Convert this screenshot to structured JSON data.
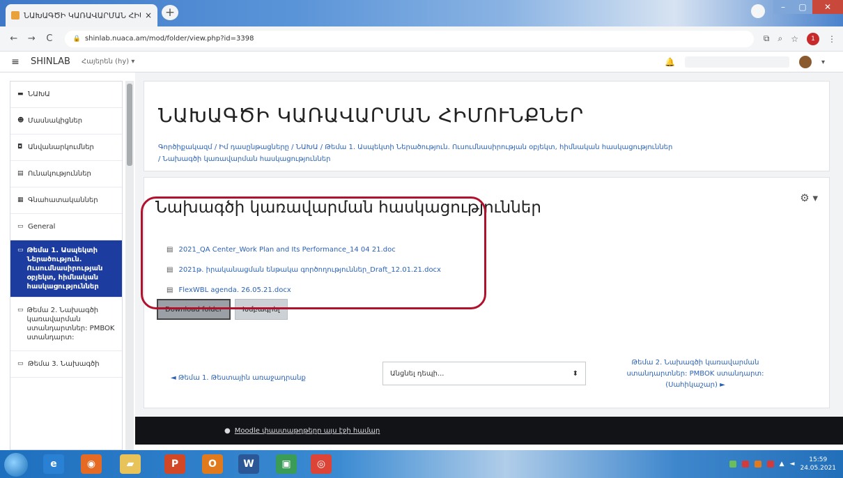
{
  "browser": {
    "tab_title": "ՆԱԽԱԳԾԻ ԿԱՌԱՎԱՐՄԱՆ ՀԻՄՈՒՆՔՆԵՐ",
    "tab_close": "×",
    "new_tab": "+",
    "url": "shinlab.nuaca.am/mod/folder/view.php?id=3398",
    "profile_initial": "1"
  },
  "moodle_nav": {
    "brand": "SHINLAB",
    "language": "Հայերեն (hy) ▾",
    "menu_icon": "≡"
  },
  "sidebar": {
    "items": [
      {
        "icon": "▬",
        "label": "ՆԱԽԱ"
      },
      {
        "icon": "☻",
        "label": "Մասնակիցներ"
      },
      {
        "icon": "◘",
        "label": "Անվանարկումներ"
      },
      {
        "icon": "▤",
        "label": "Ունակություններ"
      },
      {
        "icon": "▦",
        "label": "Գնահատականներ"
      },
      {
        "icon": "▭",
        "label": "General"
      },
      {
        "icon": "▭",
        "label": "Թեմա 1. Ասպեկտի Ներածություն. Ուսումնասիրության օբյեկտ, հիմնական հասկացություններ"
      },
      {
        "icon": "▭",
        "label": "Թեմա 2. Նախագծի կառավարման ստանդարտներ: PMBOK ստանդարտ:"
      },
      {
        "icon": "▭",
        "label": "Թեմա 3. Նախագծի"
      }
    ]
  },
  "course": {
    "title": "ՆԱԽԱԳԾԻ ԿԱՌԱՎԱՐՄԱՆ ՀԻՄՈՒՆՔՆԵՐ",
    "breadcrumb_line1": "Գործիքակազմ / Իմ դասընթացները / ՆԱԽԱ / Թեմա 1. Ասպեկտի Ներածություն. Ուսումնասիրության օբյեկտ, հիմնական հասկացություններ",
    "breadcrumb_line2": "/ Նախագծի կառավարման հասկացություններ"
  },
  "folder": {
    "title": "Նախագծի կառավարման հասկացություններ",
    "files": [
      "2021_QA Center_Work Plan and Its Performance_14 04 21.doc",
      "2021թ. իրականացման ենթակա գործողություններ_Draft_12.01.21.docx",
      "FlexWBL agenda. 26.05.21.docx"
    ],
    "download_label": "Download folder",
    "edit_label": "Խմբագրել",
    "gear_icon": "⚙ ▾"
  },
  "navigation": {
    "prev_label": "◄ Թեմա 1. Թեստային առաջադրանք",
    "jump_placeholder": "Անցնել դեպի...",
    "next_label": "Թեմա 2. Նախագծի կառավարման ստանդարտներ: PMBOK ստանդարտ: (Սահիկաշար) ►"
  },
  "footer": {
    "doc_link": "Moodle փաստաթղթերը այս էջի համար"
  },
  "taskbar": {
    "time": "15:59",
    "date": "24.05.2021"
  }
}
